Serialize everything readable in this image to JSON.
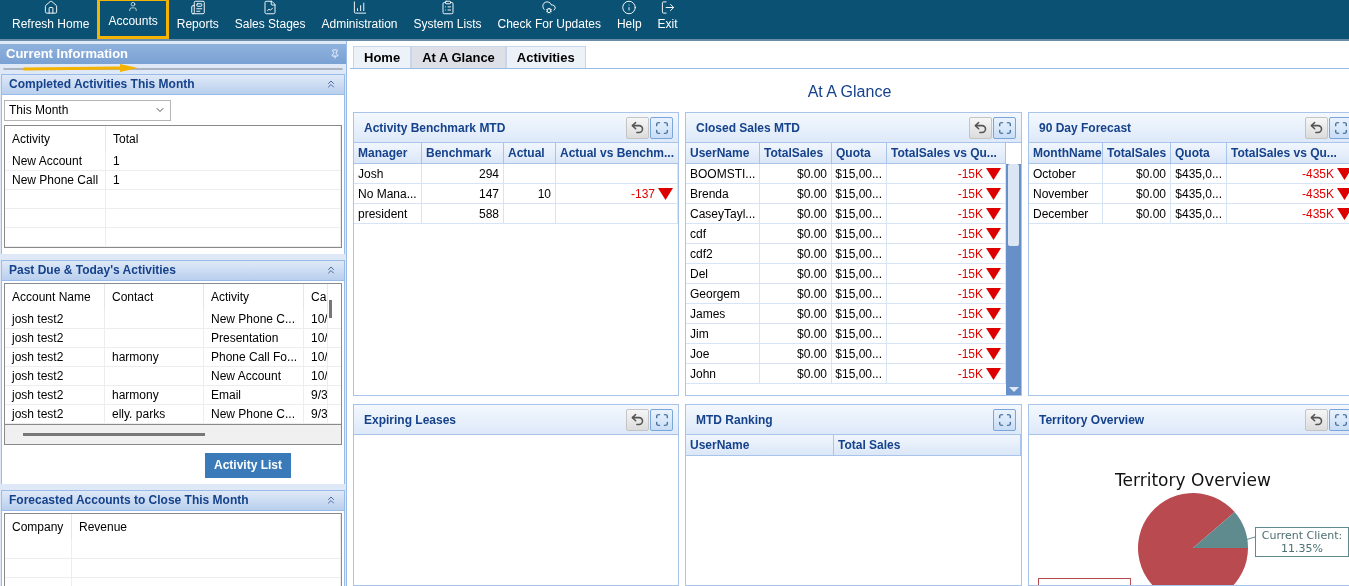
{
  "nav": [
    {
      "label": "Refresh Home",
      "highlighted": false
    },
    {
      "label": "Accounts",
      "highlighted": true
    },
    {
      "label": "Reports",
      "highlighted": false
    },
    {
      "label": "Sales Stages",
      "highlighted": false
    },
    {
      "label": "Administration",
      "highlighted": false
    },
    {
      "label": "System Lists",
      "highlighted": false
    },
    {
      "label": "Check For Updates",
      "highlighted": false
    },
    {
      "label": "Help",
      "highlighted": false
    },
    {
      "label": "Exit",
      "highlighted": false
    }
  ],
  "side_panel": {
    "title": "Current Information",
    "completed": {
      "title": "Completed Activities This Month",
      "period": "This Month",
      "columns": [
        "Activity",
        "Total"
      ],
      "rows": [
        [
          "New Account",
          "1"
        ],
        [
          "New Phone Call",
          "1"
        ]
      ]
    },
    "past_due": {
      "title": "Past Due & Today's Activities",
      "columns": [
        "Account Name",
        "Contact",
        "Activity",
        "Ca"
      ],
      "rows": [
        [
          "josh test2",
          null,
          "New Phone C...",
          "10/"
        ],
        [
          "josh test2",
          null,
          "Presentation",
          "10/"
        ],
        [
          "josh test2",
          "harmony",
          "Phone Call Fo...",
          "10/"
        ],
        [
          "josh test2",
          null,
          "New Account",
          "10/"
        ],
        [
          "josh test2",
          "harmony",
          "Email",
          "9/3"
        ],
        [
          "josh test2",
          "elly. parks",
          "New Phone C...",
          "9/3"
        ]
      ],
      "button": "Activity List"
    },
    "forecasted": {
      "title": "Forecasted Accounts to Close This Month",
      "columns": [
        "Company",
        "Revenue"
      ]
    }
  },
  "tabs": [
    {
      "label": "Home",
      "selected": false
    },
    {
      "label": "At A Glance",
      "selected": true
    },
    {
      "label": "Activities",
      "selected": false
    }
  ],
  "page_title": "At A Glance",
  "portlets": [
    {
      "kind": "table",
      "title": "Activity Benchmark MTD",
      "undo": true,
      "scrollbar": false,
      "columns": [
        "Manager",
        "Benchmark",
        "Actual",
        "Actual vs Benchm..."
      ],
      "rows": [
        {
          "cells": [
            "Josh",
            "294",
            null,
            null
          ],
          "down": false
        },
        {
          "cells": [
            "No Mana...",
            "147",
            "10",
            "-137"
          ],
          "down": true
        },
        {
          "cells": [
            "president",
            "588",
            null,
            null
          ],
          "down": false
        }
      ]
    },
    {
      "kind": "table",
      "title": "Closed Sales MTD",
      "undo": true,
      "scrollbar": true,
      "columns": [
        "UserName",
        "TotalSales",
        "Quota",
        "TotalSales vs Qu..."
      ],
      "rows": [
        {
          "cells": [
            "BOOMSTI...",
            "$0.00",
            "$15,00...",
            "-15K"
          ],
          "down": true
        },
        {
          "cells": [
            "Brenda",
            "$0.00",
            "$15,00...",
            "-15K"
          ],
          "down": true
        },
        {
          "cells": [
            "CaseyTayl...",
            "$0.00",
            "$15,00...",
            "-15K"
          ],
          "down": true
        },
        {
          "cells": [
            "cdf",
            "$0.00",
            "$15,00...",
            "-15K"
          ],
          "down": true
        },
        {
          "cells": [
            "cdf2",
            "$0.00",
            "$15,00...",
            "-15K"
          ],
          "down": true
        },
        {
          "cells": [
            "Del",
            "$0.00",
            "$15,00...",
            "-15K"
          ],
          "down": true
        },
        {
          "cells": [
            "Georgem",
            "$0.00",
            "$15,00...",
            "-15K"
          ],
          "down": true
        },
        {
          "cells": [
            "James",
            "$0.00",
            "$15,00...",
            "-15K"
          ],
          "down": true
        },
        {
          "cells": [
            "Jim",
            "$0.00",
            "$15,00...",
            "-15K"
          ],
          "down": true
        },
        {
          "cells": [
            "Joe",
            "$0.00",
            "$15,00...",
            "-15K"
          ],
          "down": true
        },
        {
          "cells": [
            "John",
            "$0.00",
            "$15,00...",
            "-15K"
          ],
          "down": true
        }
      ]
    },
    {
      "kind": "table",
      "title": "90 Day Forecast",
      "undo": true,
      "scrollbar": false,
      "columns": [
        "MonthName",
        "TotalSales",
        "Quota",
        "TotalSales vs Qu..."
      ],
      "rows": [
        {
          "cells": [
            "October",
            "$0.00",
            "$435,0...",
            "-435K"
          ],
          "down": true
        },
        {
          "cells": [
            "November",
            "$0.00",
            "$435,0...",
            "-435K"
          ],
          "down": true
        },
        {
          "cells": [
            "December",
            "$0.00",
            "$435,0...",
            "-435K"
          ],
          "down": true
        }
      ]
    },
    {
      "kind": "empty",
      "title": "Expiring Leases",
      "undo": true
    },
    {
      "kind": "table",
      "title": "MTD Ranking",
      "undo": false,
      "scrollbar": false,
      "columns": [
        "UserName",
        "Total Sales"
      ]
    },
    {
      "kind": "chart",
      "title": "Territory Overview",
      "undo": true,
      "chart_title": "Territory Overview",
      "slice_label": "Current Client: 11.35%"
    }
  ]
}
